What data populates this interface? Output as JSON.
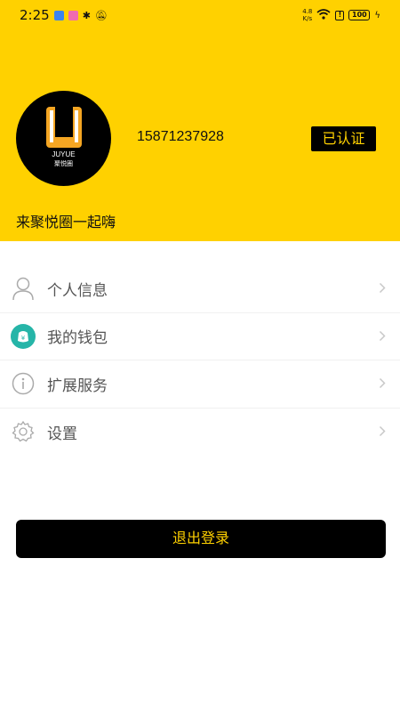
{
  "status_bar": {
    "time": "2:25",
    "net_speed_value": "4.8",
    "net_speed_unit": "K/s",
    "battery": "100",
    "wifi_signal": "6"
  },
  "profile": {
    "avatar_brand": "JUYUE",
    "avatar_letter": "U",
    "avatar_subtitle": "聚悦圈",
    "phone": "15871237928",
    "verified_label": "已认证",
    "slogan": "来聚悦圈一起嗨"
  },
  "menu": {
    "items": [
      {
        "label": "个人信息",
        "icon": "person-icon"
      },
      {
        "label": "我的钱包",
        "icon": "wallet-icon"
      },
      {
        "label": "扩展服务",
        "icon": "info-icon"
      },
      {
        "label": "设置",
        "icon": "gear-icon"
      }
    ]
  },
  "logout": {
    "label": "退出登录"
  },
  "colors": {
    "brand_yellow": "#ffd100",
    "black": "#000000",
    "wallet_teal": "#26b5a8"
  }
}
